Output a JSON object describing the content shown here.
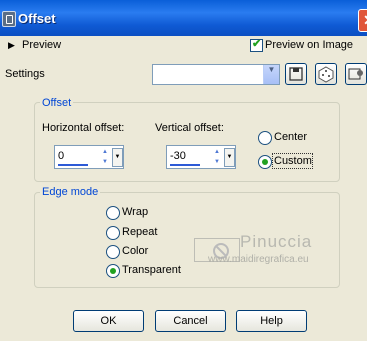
{
  "window": {
    "title": "Offset",
    "close_glyph": "✕"
  },
  "toolbar": {
    "preview_label": "Preview",
    "preview_on_image_label": "Preview on Image",
    "preview_on_image_checked": true
  },
  "settings": {
    "label": "Settings",
    "value": "",
    "icons": [
      "save-preset-icon",
      "randomize-dice-icon",
      "manage-presets-icon"
    ]
  },
  "offset": {
    "group_label": "Offset",
    "horizontal_label": "Horizontal offset:",
    "horizontal_value": "0",
    "vertical_label": "Vertical offset:",
    "vertical_value": "-30",
    "options": [
      "Center",
      "Custom"
    ],
    "selected": "Custom"
  },
  "edge_mode": {
    "group_label": "Edge mode",
    "options": [
      "Wrap",
      "Repeat",
      "Color",
      "Transparent"
    ],
    "selected": "Transparent"
  },
  "watermark": {
    "name": "Pinuccia",
    "site": "www.maidiregrafica.eu"
  },
  "buttons": {
    "ok": "OK",
    "cancel": "Cancel",
    "help": "Help"
  }
}
